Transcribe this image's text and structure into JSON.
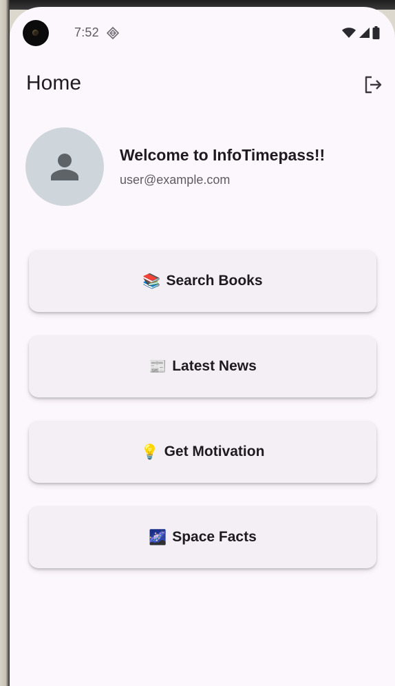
{
  "status_bar": {
    "time": "7:52"
  },
  "app_bar": {
    "title": "Home"
  },
  "profile": {
    "welcome": "Welcome to InfoTimepass!!",
    "email": "user@example.com"
  },
  "menu": [
    {
      "emoji": "📚",
      "label": "Search Books"
    },
    {
      "emoji": "📰",
      "label": "Latest News"
    },
    {
      "emoji": "💡",
      "label": "Get Motivation"
    },
    {
      "emoji": "🌌",
      "label": "Space Facts"
    }
  ],
  "icons": {
    "status_gem": "diamond-icon",
    "wifi": "wifi-icon",
    "signal": "cell-signal-icon",
    "battery": "battery-icon",
    "logout": "logout-icon",
    "avatar": "person-icon"
  },
  "colors": {
    "background": "#fcf7fd",
    "button": "#f4eff4",
    "avatar_bg": "#cfd6db",
    "text": "#1d1b20"
  }
}
